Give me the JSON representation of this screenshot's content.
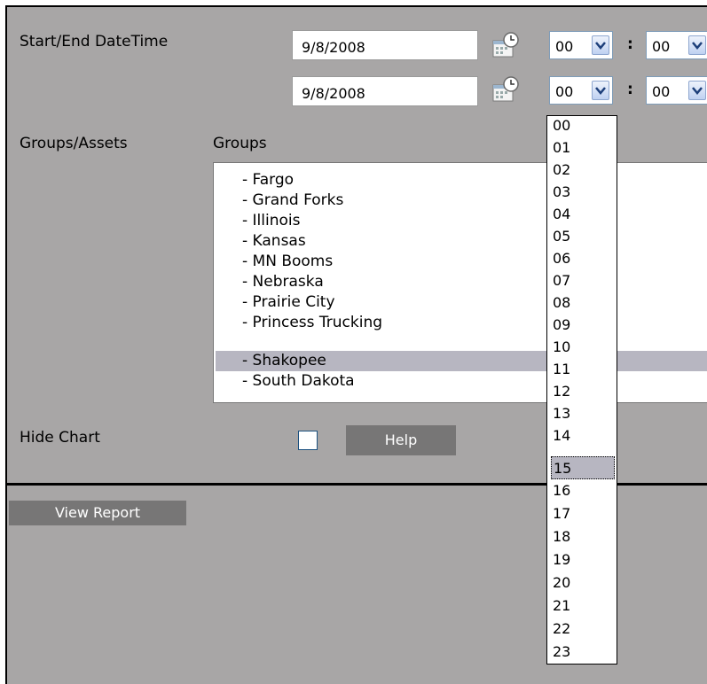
{
  "form": {
    "start_end_label": "Start/End DateTime",
    "start_date": "9/8/2008",
    "end_date": "9/8/2008",
    "start_hour": "00",
    "start_minute": "00",
    "end_hour": "00",
    "end_minute": "00",
    "colon": ":",
    "groups_assets_label": "Groups/Assets",
    "groups_label": "Groups",
    "hide_chart_label": "Hide Chart",
    "hide_chart_checked": false,
    "help_button": "Help",
    "view_report_button": "View Report"
  },
  "groups_list": {
    "items": [
      "- Fargo",
      "- Grand Forks",
      "- Illinois",
      "- Kansas",
      "- MN Booms",
      "- Nebraska",
      "- Prairie City",
      "- Princess Trucking",
      "- Shakopee",
      "- South Dakota"
    ],
    "selected": "- Shakopee"
  },
  "hour_dropdown": {
    "options": [
      "00",
      "01",
      "02",
      "03",
      "04",
      "05",
      "06",
      "07",
      "08",
      "09",
      "10",
      "11",
      "12",
      "13",
      "14",
      "15",
      "16",
      "17",
      "18",
      "19",
      "20",
      "21",
      "22",
      "23"
    ],
    "highlighted": "15"
  },
  "icons": {
    "calendar": "calendar-clock-icon",
    "dropdown_arrow": "chevron-down-icon"
  },
  "colors": {
    "panel_bg": "#a8a6a6",
    "button_bg": "#777676",
    "selection_bg": "#b7b6c1"
  }
}
